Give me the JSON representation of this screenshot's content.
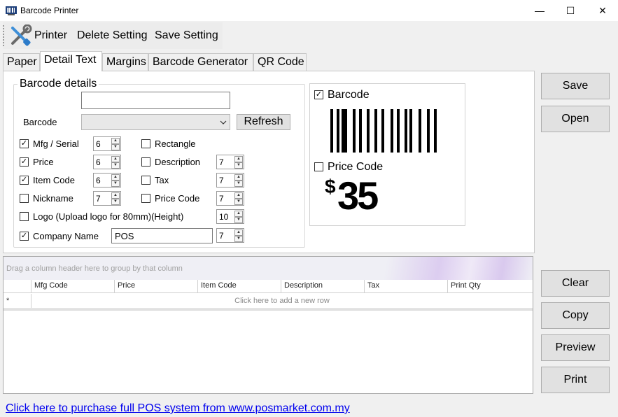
{
  "window": {
    "title": "Barcode Printer",
    "minimize_glyph": "—",
    "maximize_glyph": "☐",
    "close_glyph": "✕"
  },
  "toolbar": {
    "items": [
      "Printer",
      "Delete Setting",
      "Save Setting"
    ]
  },
  "tabs": [
    "Paper",
    "Detail Text",
    "Margins",
    "Barcode Generator",
    "QR Code"
  ],
  "active_tab": "Detail Text",
  "details": {
    "group_title": "Barcode details",
    "top_input_value": "",
    "barcode_label": "Barcode",
    "barcode_value": "",
    "refresh_label": "Refresh",
    "left_rows": [
      {
        "label": "Mfg / Serial",
        "checked": true,
        "size": "6"
      },
      {
        "label": "Price",
        "checked": true,
        "size": "6"
      },
      {
        "label": "Item Code",
        "checked": true,
        "size": "6"
      },
      {
        "label": "Nickname",
        "checked": false,
        "size": "7"
      }
    ],
    "right_rows": [
      {
        "label": "Rectangle",
        "checked": false
      },
      {
        "label": "Description",
        "checked": false,
        "size": "7"
      },
      {
        "label": "Tax",
        "checked": false,
        "size": "7"
      },
      {
        "label": "Price Code",
        "checked": false,
        "size": "7"
      }
    ],
    "logo": {
      "label": "Logo (Upload logo for 80mm)(Height)",
      "checked": false,
      "size": "10"
    },
    "company": {
      "label": "Company Name",
      "checked": true,
      "value": "POS",
      "size": "7"
    }
  },
  "preview": {
    "barcode_label": "Barcode",
    "barcode_checked": true,
    "price_code_label": "Price Code",
    "price_code_checked": false,
    "currency_symbol": "$",
    "price_value": "35"
  },
  "right_buttons": {
    "save": "Save",
    "open": "Open",
    "clear": "Clear",
    "copy": "Copy",
    "preview": "Preview",
    "print": "Print"
  },
  "grid": {
    "group_hint": "Drag a column header here to group by that column",
    "columns": [
      "Mfg Code",
      "Price",
      "Item Code",
      "Description",
      "Tax",
      "Print Qty"
    ],
    "new_row_indicator": "*",
    "new_row_text": "Click here to add a new row"
  },
  "footer": {
    "link_text": "Click here to purchase full POS system from www.posmarket.com.my"
  },
  "icons": {
    "app": "barcode-printer-app-icon",
    "toolbar": "wrench-screwdriver-icon",
    "check": "checkmark-icon",
    "spin": "up-down-arrow-icon"
  }
}
